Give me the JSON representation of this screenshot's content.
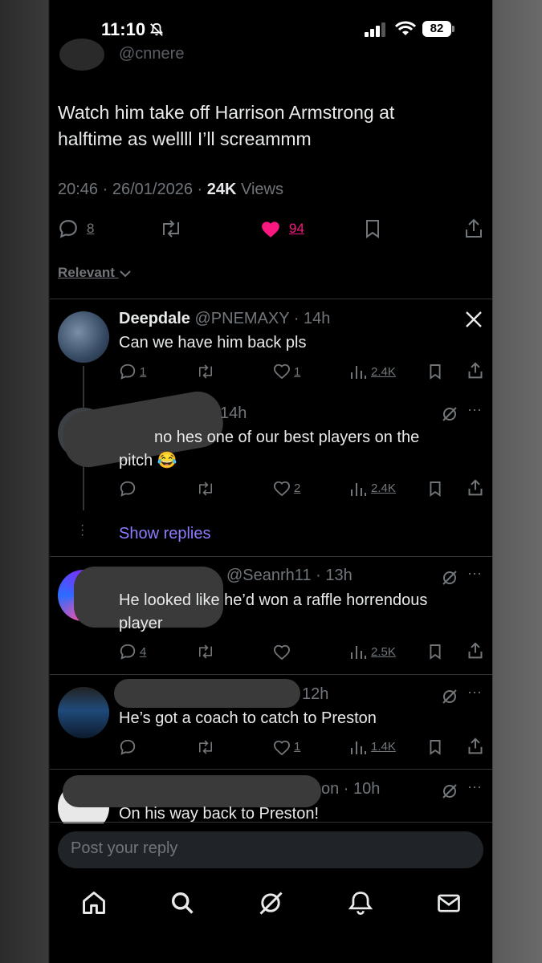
{
  "status_bar": {
    "time": "11:10",
    "battery": "82"
  },
  "tweet": {
    "handle_partial": "@cnnere",
    "text": "Watch him take off Harrison Armstrong at halftime as wellll I’ll screammm",
    "time": "20:46",
    "date": "26/01/2026",
    "views_count": "24K",
    "views_label": "Views",
    "replies": "8",
    "likes": "94"
  },
  "sort_label": "Relevant",
  "replies": [
    {
      "name": "Deepdale",
      "handle": "@PNEMAXY",
      "age": "14h",
      "text": "Can we have him back pls",
      "replies": "1",
      "likes": "1",
      "views": "2.4K"
    },
    {
      "age": "14h",
      "text": "no hes one of our best players on the pitch 😂",
      "likes": "2",
      "views": "2.4K"
    },
    {
      "handle": "@Seanrh11",
      "age": "13h",
      "text": "He looked like he’d won a raffle horrendous player",
      "replies": "4",
      "views": "2.5K"
    },
    {
      "age": "12h",
      "text": "He’s got a coach to catch to Preston",
      "likes": "1",
      "views": "1.4K"
    },
    {
      "age": "on · 10h",
      "text": "On his way back to Preston!"
    }
  ],
  "show_replies": "Show replies",
  "reply_placeholder": "Post your reply",
  "colors": {
    "like": "#f91880",
    "link": "#8c7cff",
    "muted": "#71767b",
    "background": "#000000"
  }
}
